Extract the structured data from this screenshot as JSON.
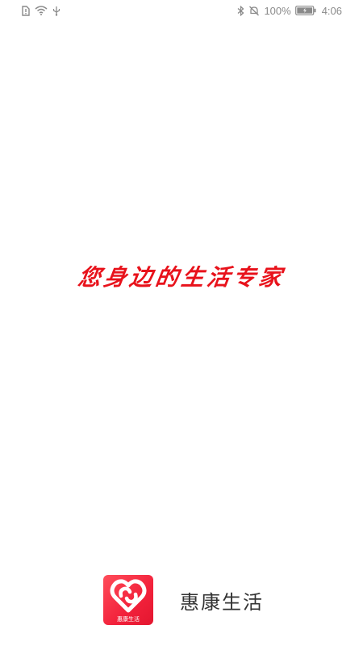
{
  "status_bar": {
    "battery_percent": "100%",
    "time": "4:06",
    "icons": [
      "sim-alert-icon",
      "wifi-icon",
      "usb-icon",
      "bluetooth-icon",
      "mute-icon",
      "battery-icon"
    ],
    "color": "#8a8a8a"
  },
  "splash": {
    "slogan": "您身边的生活专家",
    "slogan_color": "#e8121b"
  },
  "brand": {
    "logo_caption": "惠康生活",
    "app_name": "惠康生活",
    "logo_color": "#f2213b"
  }
}
